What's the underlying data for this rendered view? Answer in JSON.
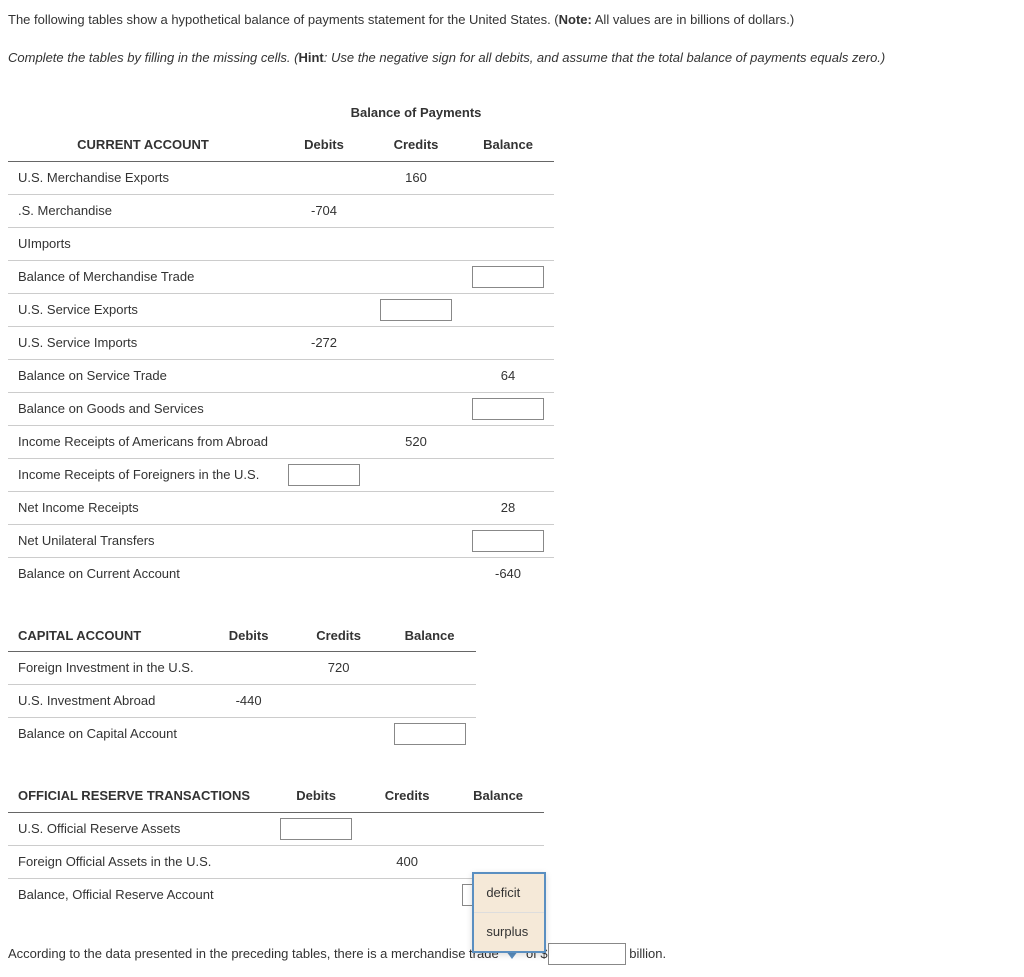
{
  "intro": "The following tables show a hypothetical balance of payments statement for the United States. (",
  "intro_note_label": "Note:",
  "intro_note_text": " All values are in billions of dollars.)",
  "hint_prefix": "Complete the tables by filling in the missing cells. (",
  "hint_label": "Hint",
  "hint_text": ": Use the negative sign for all debits, and assume that the total balance of payments equals zero.)",
  "table1": {
    "title": "Balance of Payments",
    "header_account": "CURRENT ACCOUNT",
    "header_debits": "Debits",
    "header_credits": "Credits",
    "header_balance": "Balance",
    "rows": [
      {
        "label": "U.S. Merchandise Exports",
        "debits": "",
        "credits": "160",
        "balance": ""
      },
      {
        "label": ".S. Merchandise",
        "debits": "-704",
        "credits": "",
        "balance": ""
      },
      {
        "label": "UImports",
        "debits": "",
        "credits": "",
        "balance": ""
      },
      {
        "label": "Balance of Merchandise Trade",
        "debits": "",
        "credits": "",
        "balance_input": true
      },
      {
        "label": "U.S. Service Exports",
        "debits": "",
        "credits_input": true,
        "balance": ""
      },
      {
        "label": "U.S. Service Imports",
        "debits": "-272",
        "credits": "",
        "balance": ""
      },
      {
        "label": "Balance on Service Trade",
        "debits": "",
        "credits": "",
        "balance": "64"
      },
      {
        "label": "Balance on Goods and Services",
        "debits": "",
        "credits": "",
        "balance_input": true
      },
      {
        "label": "Income Receipts of Americans from Abroad",
        "debits": "",
        "credits": "520",
        "balance": ""
      },
      {
        "label": "Income Receipts of Foreigners in the U.S.",
        "debits_input": true,
        "credits": "",
        "balance": ""
      },
      {
        "label": "Net Income Receipts",
        "debits": "",
        "credits": "",
        "balance": "28"
      },
      {
        "label": "Net Unilateral Transfers",
        "debits": "",
        "credits": "",
        "balance_input": true
      },
      {
        "label": "Balance on Current Account",
        "debits": "",
        "credits": "",
        "balance": "-640"
      }
    ]
  },
  "table2": {
    "header_account": "CAPITAL ACCOUNT",
    "header_debits": "Debits",
    "header_credits": "Credits",
    "header_balance": "Balance",
    "rows": [
      {
        "label": "Foreign Investment in the U.S.",
        "debits": "",
        "credits": "720",
        "balance": ""
      },
      {
        "label": "U.S. Investment Abroad",
        "debits": "-440",
        "credits": "",
        "balance": ""
      },
      {
        "label": "Balance on Capital Account",
        "debits": "",
        "credits": "",
        "balance_input": true
      }
    ]
  },
  "table3": {
    "header_account": "OFFICIAL RESERVE TRANSACTIONS",
    "header_debits": "Debits",
    "header_credits": "Credits",
    "header_balance": "Balance",
    "rows": [
      {
        "label": "U.S. Official Reserve Assets",
        "debits_input": true,
        "credits": "",
        "balance": ""
      },
      {
        "label": "Foreign Official Assets in the U.S.",
        "debits": "",
        "credits": "400",
        "balance": ""
      },
      {
        "label": "Balance, Official Reserve Account",
        "debits": "",
        "credits": "",
        "balance_input": true
      }
    ]
  },
  "sentence": {
    "prefix": "According to the data presented in the preceding tables, there is a merchandise trade ",
    "of": " of ",
    "dollar": "$",
    "suffix": " billion."
  },
  "dropdown": {
    "options": [
      "deficit",
      "surplus"
    ]
  }
}
